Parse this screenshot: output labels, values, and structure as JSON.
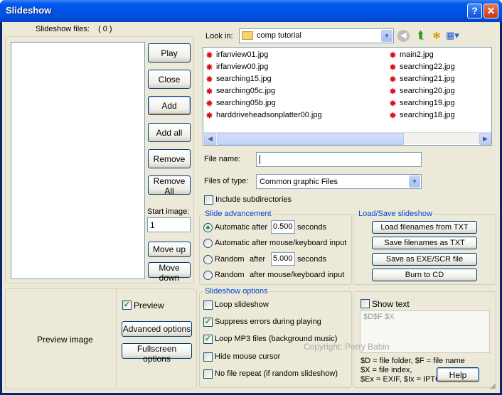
{
  "window": {
    "title": "Slideshow"
  },
  "slideshow_files": {
    "label": "Slideshow files:",
    "count": "( 0 )"
  },
  "buttons": {
    "play": "Play",
    "close": "Close",
    "add": "Add",
    "add_all": "Add all",
    "remove": "Remove",
    "remove_all": "Remove All",
    "move_up": "Move up",
    "move_down": "Move down",
    "advanced_options": "Advanced options",
    "fullscreen_options": "Fullscreen options",
    "help": "Help"
  },
  "start_image": {
    "label": "Start image:",
    "value": "1"
  },
  "preview": {
    "label": "Preview image",
    "checkbox_label": "Preview",
    "checked": true
  },
  "look_in": {
    "label": "Look in:",
    "value": "comp tutorial"
  },
  "files_left": [
    "irfanview01.jpg",
    "irfanview00.jpg",
    "searching15.jpg",
    "searching05c.jpg",
    "searching05b.jpg",
    "harddriveheadsonplatter00.jpg"
  ],
  "files_right": [
    "main2.jpg",
    "searching22.jpg",
    "searching21.jpg",
    "searching20.jpg",
    "searching19.jpg",
    "searching18.jpg"
  ],
  "file_name": {
    "label": "File name:",
    "value": ""
  },
  "files_of_type": {
    "label": "Files of type:",
    "value": "Common graphic Files"
  },
  "include_subdirectories": {
    "label": "Include subdirectories",
    "checked": false
  },
  "slide_advancement": {
    "title": "Slide advancement",
    "auto_after": "Automatic after",
    "auto_value": "0.500",
    "seconds": "seconds",
    "auto_mouse": "Automatic after mouse/keyboard input",
    "random": "Random",
    "after": "after",
    "random_value": "5.000",
    "random_mouse_a": "Random",
    "random_mouse_b": "after mouse/keyboard input"
  },
  "load_save": {
    "title": "Load/Save slideshow",
    "load_txt": "Load filenames from TXT",
    "save_txt": "Save filenames as TXT",
    "save_exe": "Save as  EXE/SCR file",
    "burn_cd": "Burn to CD"
  },
  "slideshow_options": {
    "title": "Slideshow options",
    "loop": "Loop slideshow",
    "suppress": "Suppress errors during playing",
    "loop_mp3": "Loop MP3 files (background music)",
    "hide_mouse": "Hide mouse cursor",
    "no_repeat": "No file repeat (if random slideshow)"
  },
  "show_text": {
    "label": "Show text",
    "value": "$D$F $X",
    "help1": "$D = file folder, $F = file name",
    "help2": "$X = file index,",
    "help3": "$Ex = EXIF, $Ix = IPTC ..."
  },
  "watermark": "Copyright: Perry Babin"
}
